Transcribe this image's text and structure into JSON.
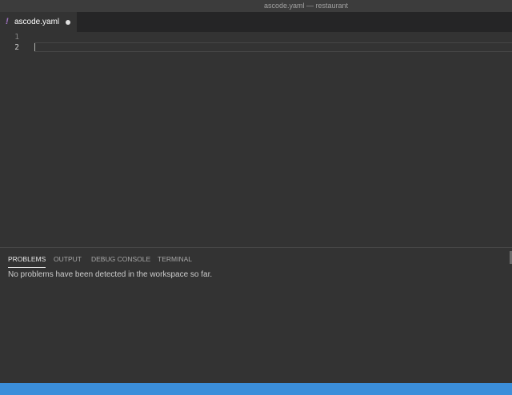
{
  "window": {
    "title": "ascode.yaml — restaurant"
  },
  "tabs": [
    {
      "label": "ascode.yaml",
      "icon": "yaml-file-icon",
      "icon_glyph": "!",
      "dirty": true,
      "active": true
    }
  ],
  "editor": {
    "line_numbers": [
      "1",
      "2"
    ],
    "active_line": 2
  },
  "panel": {
    "tabs": [
      {
        "label": "PROBLEMS",
        "active": true
      },
      {
        "label": "OUTPUT",
        "active": false
      },
      {
        "label": "DEBUG CONSOLE",
        "active": false
      },
      {
        "label": "TERMINAL",
        "active": false
      }
    ],
    "message": "No problems have been detected in the workspace so far."
  },
  "colors": {
    "status_bar": "#3b8eda",
    "yaml_icon": "#a074c4",
    "background": "#333333"
  }
}
